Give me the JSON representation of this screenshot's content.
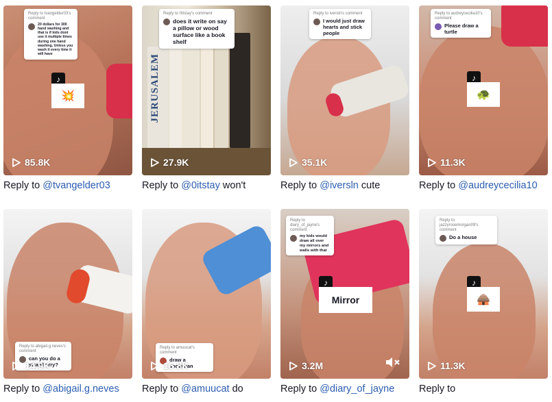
{
  "videos": [
    {
      "comment_header": "Reply to tvangelder03's comment",
      "comment_text": "20 dollars for 300 hand washing and that is if kids dont use it multiple times during one hand washing. Unless you wash it every time it will have",
      "sticker": "💥",
      "views": "85.8K",
      "caption_prefix": "Reply to ",
      "mention": "@tvangelder03",
      "caption_rest": ""
    },
    {
      "comment_header": "Reply to 0itstay's comment",
      "comment_text": "does it write on say a pillow or wood surface like a book shelf",
      "book_title": "JERUSALEM",
      "views": "27.9K",
      "caption_prefix": "Reply to ",
      "mention": "@0itstay",
      "caption_rest": " won't"
    },
    {
      "comment_header": "Reply to iversln's comment",
      "comment_text": "I would just draw hearts and stick people",
      "views": "35.1K",
      "caption_prefix": "Reply to ",
      "mention": "@iversln",
      "caption_rest": " cute"
    },
    {
      "comment_header": "Reply to audreycecilia10's comment",
      "comment_text": "Please draw a turtle",
      "sticker": "🐢",
      "views": "11.3K",
      "caption_prefix": "Reply to ",
      "mention": "@audreycecilia10",
      "caption_rest": ""
    },
    {
      "comment_header": "Reply to abigail.g.neves's comment",
      "comment_text": "can you do a strawberry?",
      "views": "14.9K",
      "caption_prefix": "Reply to ",
      "mention": "@abigail.g.neves",
      "caption_rest": ""
    },
    {
      "comment_header": "Reply to amuucat's comment",
      "comment_text": "draw a snowman",
      "views": "16.8K",
      "caption_prefix": "Reply to ",
      "mention": "@amuucat",
      "caption_rest": " do"
    },
    {
      "comment_header": "Reply to diary_of_jayne's comment",
      "comment_text": "my kids would draw all over my mirrors and walls with that",
      "sticker": "Mirror",
      "views": "3.2M",
      "mute_icon": "🔇",
      "caption_prefix": "Reply to ",
      "mention": "@diary_of_jayne",
      "caption_rest": ""
    },
    {
      "comment_header": "Reply to jazzyrosemorgan09's comment",
      "comment_text": "Do a house",
      "sticker": "🛖",
      "views": "11.3K",
      "caption_prefix": "Reply to ",
      "mention": "",
      "caption_rest": ""
    }
  ],
  "icons": {
    "play": "play-icon",
    "tiktok": "tiktok-logo-icon",
    "mute": "mute-icon"
  },
  "colors": {
    "mention": "#2b5db0",
    "text": "#161823",
    "views": "#ffffff"
  }
}
